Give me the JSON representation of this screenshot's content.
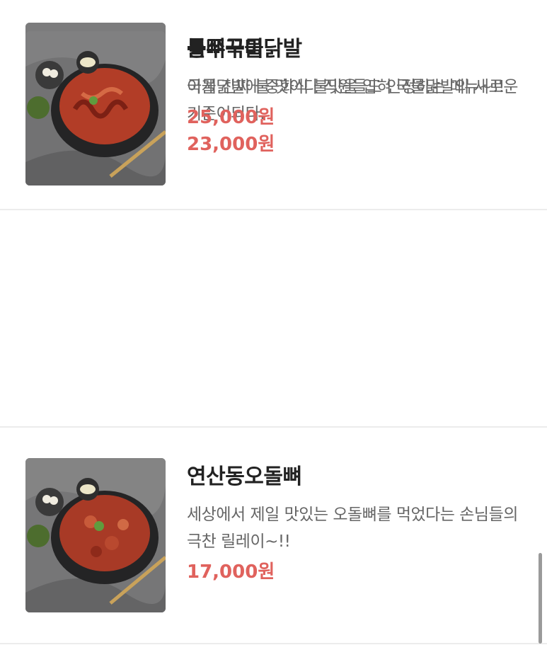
{
  "menu": {
    "items": [
      {
        "name": "통뼈국물닭발",
        "description": "국물닭발에 중화식 불맛을 입혀 국물닭발의 새로운 기준이되다.",
        "price": "23,000원",
        "image_icon": "spicy-chicken-feet-soup-photo"
      },
      {
        "name": "연산동오돌뼈",
        "description": "세상에서 제일 맛있는 오돌뼈를 먹었다는 손님들의 극찬 릴레이~!!",
        "price": "17,000원",
        "image_icon": "spicy-cartilage-photo"
      },
      {
        "name": "불쭈꾸미",
        "description": "이게 진짜 불 맛이다 직원들도 인정하는 메뉴~!!",
        "price": "25,000원",
        "image_icon": "spicy-webfoot-octopus-photo"
      }
    ]
  },
  "colors": {
    "price": "#e0625d",
    "title": "#222222",
    "description": "#666666",
    "divider": "#ececec"
  }
}
